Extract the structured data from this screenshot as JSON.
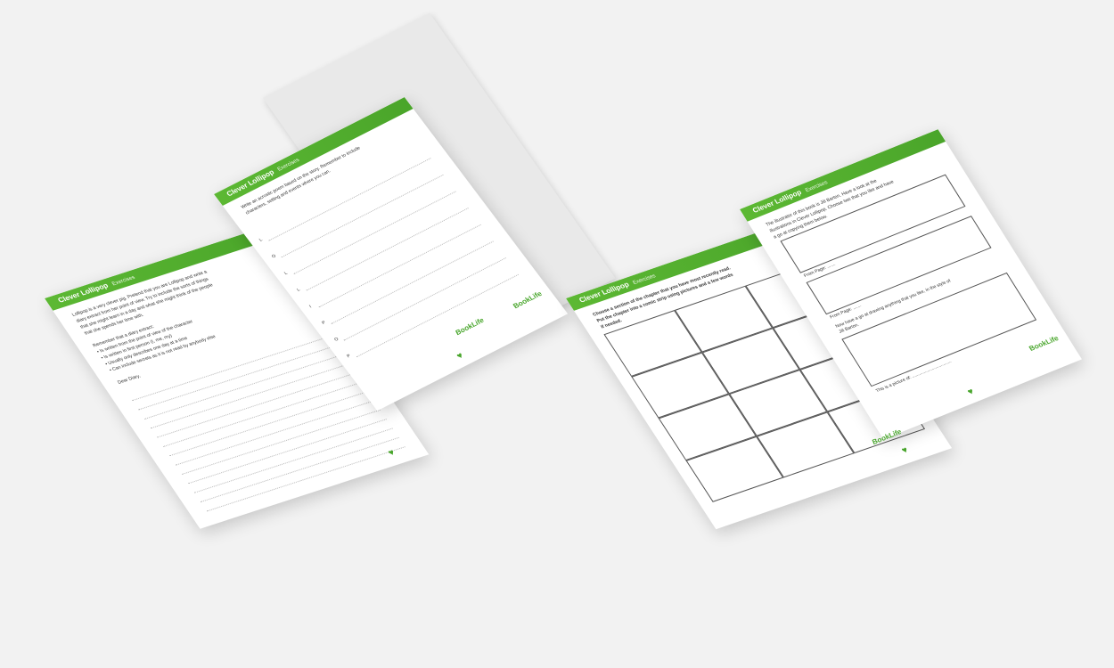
{
  "book1": {
    "left": {
      "title": "Clever Lollipop",
      "title_sub": "Exercises",
      "text": "Lollipop is a very clever pig. Pretend that you are Lollipop and write a\ndiary extract from her point of view. Try to include the sorts of things\nthat she might learn in a day and what she might think of the people\nthat she spends her time with.\n\nRemember that a diary extract:\n• Is written from the point of view of the character\n• Is written in first person (I, me, my)\n• Usually only describes one day at a time\n• Can include secrets as it is not read by anybody else\n\nDear Diary,",
      "logo": "BookLife"
    },
    "right": {
      "title": "Clever Lollipop",
      "title_sub": "Exercises",
      "text": "Write an acrostic poem based on the story. Remember to include\ncharacters, setting and events where you can.",
      "letters": [
        "L",
        "O",
        "L",
        "L",
        "I",
        "P",
        "O",
        "P"
      ],
      "logo": "BookLife"
    }
  },
  "book2": {
    "left": {
      "title": "Clever Lollipop",
      "title_sub": "Exercises",
      "text": "Choose a section of the chapter that you have most recently read.\nPut the chapter into a comic strip using pictures and a few words\nif needed.",
      "logo": "BookLife"
    },
    "right": {
      "title": "Clever Lollipop",
      "title_sub": "Exercises",
      "text": "The illustrator of this book is Jill Barton. Have a look at the\nillustrations in Clever Lollipop. Choose two that you like and have\na go at copying them below.",
      "from_page_1": "From Page: .......",
      "from_page_2": "From Page: .......",
      "drawing_text": "Now have a go at drawing anything that you like, in the style of\nJill Barton.",
      "picture_caption": "This is a picture of: ..................................",
      "logo": "BookLife"
    }
  }
}
